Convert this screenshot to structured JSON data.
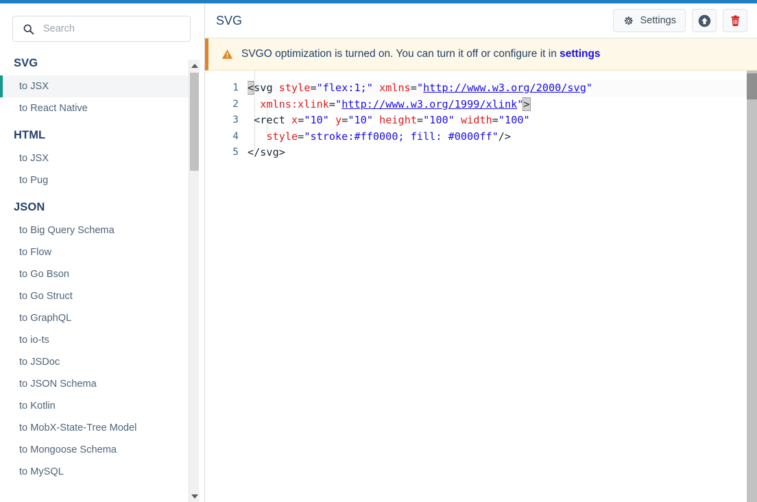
{
  "theme": {
    "topbar_color": "#1f7fc4",
    "accent_active": "#11998e",
    "banner_border": "#e08427",
    "banner_bg": "#fdf8e7",
    "link_color": "#1a0dea",
    "trash_color": "#d90d0d",
    "title_color": "#28456e"
  },
  "search": {
    "placeholder": "Search",
    "value": "",
    "icon": "search-icon"
  },
  "sidebar": {
    "groups": [
      {
        "title": "SVG",
        "items": [
          {
            "label": "to JSX",
            "active": true
          },
          {
            "label": "to React Native",
            "active": false
          }
        ]
      },
      {
        "title": "HTML",
        "items": [
          {
            "label": "to JSX",
            "active": false
          },
          {
            "label": "to Pug",
            "active": false
          }
        ]
      },
      {
        "title": "JSON",
        "items": [
          {
            "label": "to Big Query Schema",
            "active": false
          },
          {
            "label": "to Flow",
            "active": false
          },
          {
            "label": "to Go Bson",
            "active": false
          },
          {
            "label": "to Go Struct",
            "active": false
          },
          {
            "label": "to GraphQL",
            "active": false
          },
          {
            "label": "to io-ts",
            "active": false
          },
          {
            "label": "to JSDoc",
            "active": false
          },
          {
            "label": "to JSON Schema",
            "active": false
          },
          {
            "label": "to Kotlin",
            "active": false
          },
          {
            "label": "to MobX-State-Tree Model",
            "active": false
          },
          {
            "label": "to Mongoose Schema",
            "active": false
          },
          {
            "label": "to MySQL",
            "active": false
          }
        ]
      }
    ],
    "scrollbar": {
      "up_icon": "chevron-up-icon",
      "down_icon": "chevron-down-icon"
    }
  },
  "header": {
    "title": "SVG",
    "settings_label": "Settings",
    "settings_icon": "gear-icon",
    "upload_icon": "upload-circle-icon",
    "delete_icon": "trash-icon"
  },
  "banner": {
    "icon": "warning-triangle-icon",
    "text": "SVGO optimization is turned on. You can turn it off or configure it in ",
    "link_label": "settings"
  },
  "editor": {
    "line_numbers": [
      "1",
      "2",
      "3",
      "4",
      "5"
    ],
    "lines": [
      {
        "number": "1",
        "active": true,
        "tokens": [
          {
            "t": "match",
            "v": "<"
          },
          {
            "t": "tag",
            "v": "svg"
          },
          {
            "t": "plain",
            "v": " "
          },
          {
            "t": "attr",
            "v": "style"
          },
          {
            "t": "punct",
            "v": "="
          },
          {
            "t": "str",
            "v": "\"flex:1;\""
          },
          {
            "t": "plain",
            "v": " "
          },
          {
            "t": "attr",
            "v": "xmlns"
          },
          {
            "t": "punct",
            "v": "="
          },
          {
            "t": "str",
            "v": "\""
          },
          {
            "t": "url",
            "v": "http://www.w3.org/2000/svg"
          },
          {
            "t": "str",
            "v": "\""
          }
        ]
      },
      {
        "number": "2",
        "active": false,
        "tokens": [
          {
            "t": "plain",
            "v": "  "
          },
          {
            "t": "attr",
            "v": "xmlns:xlink"
          },
          {
            "t": "punct",
            "v": "="
          },
          {
            "t": "str",
            "v": "\""
          },
          {
            "t": "url",
            "v": "http://www.w3.org/1999/xlink"
          },
          {
            "t": "str",
            "v": "\""
          },
          {
            "t": "match",
            "v": ">"
          }
        ]
      },
      {
        "number": "3",
        "active": false,
        "tokens": [
          {
            "t": "plain",
            "v": " "
          },
          {
            "t": "tag",
            "v": "<rect"
          },
          {
            "t": "plain",
            "v": " "
          },
          {
            "t": "attr",
            "v": "x"
          },
          {
            "t": "punct",
            "v": "="
          },
          {
            "t": "str",
            "v": "\"10\""
          },
          {
            "t": "plain",
            "v": " "
          },
          {
            "t": "attr",
            "v": "y"
          },
          {
            "t": "punct",
            "v": "="
          },
          {
            "t": "str",
            "v": "\"10\""
          },
          {
            "t": "plain",
            "v": " "
          },
          {
            "t": "attr",
            "v": "height"
          },
          {
            "t": "punct",
            "v": "="
          },
          {
            "t": "str",
            "v": "\"100\""
          },
          {
            "t": "plain",
            "v": " "
          },
          {
            "t": "attr",
            "v": "width"
          },
          {
            "t": "punct",
            "v": "="
          },
          {
            "t": "str",
            "v": "\"100\""
          }
        ]
      },
      {
        "number": "4",
        "active": false,
        "tokens": [
          {
            "t": "plain",
            "v": "   "
          },
          {
            "t": "attr",
            "v": "style"
          },
          {
            "t": "punct",
            "v": "="
          },
          {
            "t": "str",
            "v": "\"stroke:#ff0000; fill: #0000ff\""
          },
          {
            "t": "punct",
            "v": "/>"
          }
        ]
      },
      {
        "number": "5",
        "active": false,
        "tokens": [
          {
            "t": "tag",
            "v": "</svg>"
          }
        ]
      }
    ]
  }
}
